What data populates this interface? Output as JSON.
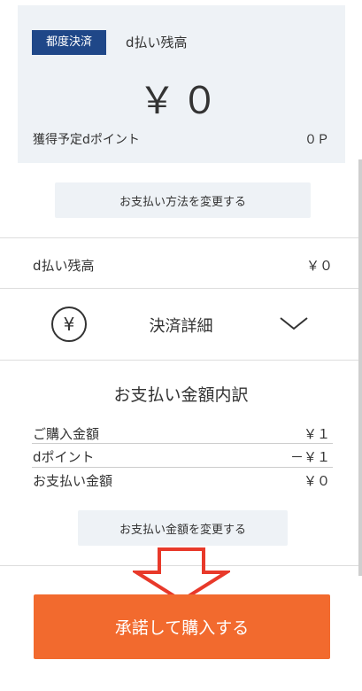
{
  "summary": {
    "badge": "都度決済",
    "label": "d払い残高",
    "amount": "￥０",
    "points_label": "獲得予定dポイント",
    "points_value": "０Ｐ"
  },
  "change_method_button": "お支払い方法を変更する",
  "balance_row": {
    "label": "d払い残高",
    "value": "￥０"
  },
  "details": {
    "title": "決済詳細",
    "icon": "yen-circle-icon"
  },
  "breakdown": {
    "title": "お支払い金額内訳",
    "rows": [
      {
        "label": "ご購入金額",
        "value": "￥１"
      },
      {
        "label": "dポイント",
        "value": "－￥１"
      },
      {
        "label": "お支払い金額",
        "value": "￥０"
      }
    ]
  },
  "change_amount_button": "お支払い金額を変更する",
  "purchase_button": "承諾して購入する",
  "colors": {
    "accent": "#f26a2e",
    "badge": "#1f4788",
    "panel": "#eef2f6",
    "arrow": "#e8392a"
  }
}
